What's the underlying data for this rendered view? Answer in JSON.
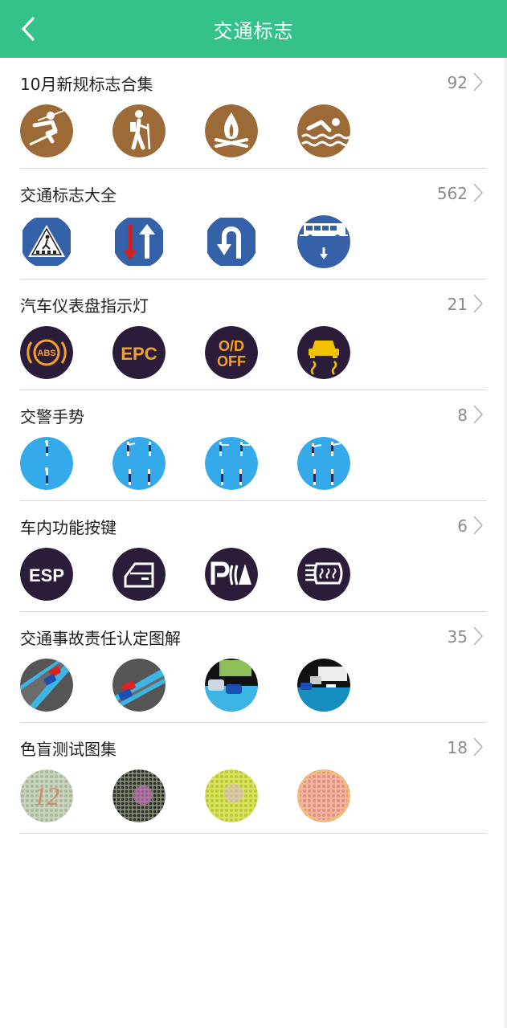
{
  "header": {
    "title": "交通标志"
  },
  "colors": {
    "header": "#35c28a",
    "brown": "#9b6a36",
    "blue": "#3561a8",
    "dark": "#2b1d3a",
    "amber": "#f2a22a",
    "sky": "#35aaea"
  },
  "sections": [
    {
      "title": "10月新规标志合集",
      "count": "92",
      "icons": [
        "skiing-icon",
        "hiking-icon",
        "campfire-icon",
        "swimming-icon"
      ]
    },
    {
      "title": "交通标志大全",
      "count": "562",
      "icons": [
        "pedestrian-crossing-icon",
        "two-way-traffic-icon",
        "u-turn-icon",
        "bus-lane-icon"
      ]
    },
    {
      "title": "汽车仪表盘指示灯",
      "count": "21",
      "icons": [
        "abs-warning-icon",
        "epc-warning-icon",
        "od-off-icon",
        "traction-control-icon"
      ]
    },
    {
      "title": "交警手势",
      "count": "8",
      "icons": [
        "police-gesture-1-icon",
        "police-gesture-2-icon",
        "police-gesture-3-icon",
        "police-gesture-4-icon"
      ]
    },
    {
      "title": "车内功能按键",
      "count": "6",
      "icons": [
        "esp-button-icon",
        "car-door-icon",
        "parking-sensor-icon",
        "windshield-heater-icon"
      ]
    },
    {
      "title": "交通事故责任认定图解",
      "count": "35",
      "icons": [
        "accident-diagram-1-icon",
        "accident-diagram-2-icon",
        "accident-diagram-3-icon",
        "accident-diagram-4-icon"
      ]
    },
    {
      "title": "色盲测试图集",
      "count": "18",
      "icons": [
        "color-plate-12-icon",
        "color-plate-2-icon",
        "color-plate-3-icon",
        "color-plate-4-icon"
      ]
    }
  ],
  "icon_text": {
    "abs": "ABS",
    "epc": "EPC",
    "od_top": "O/D",
    "od_bottom": "OFF",
    "esp": "ESP",
    "plate_number": "12"
  }
}
